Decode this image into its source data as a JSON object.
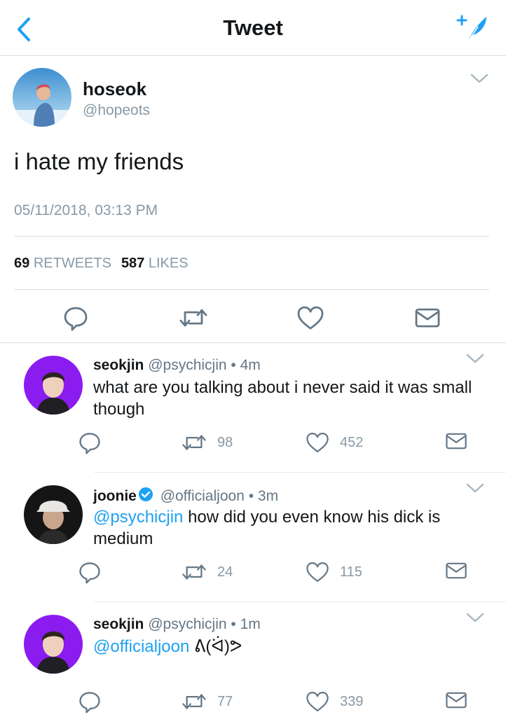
{
  "navbar": {
    "title": "Tweet",
    "back_icon": "chevron-left-icon",
    "compose_icon": "compose-feather-icon",
    "accent_color": "#1da1f2"
  },
  "main_tweet": {
    "name": "hoseok",
    "handle": "@hopeots",
    "text": "i hate my friends",
    "timestamp": "05/11/2018, 03:13 PM",
    "retweets_count": "69",
    "retweets_label": "RETWEETS",
    "likes_count": "587",
    "likes_label": "LIKES"
  },
  "replies": [
    {
      "name": "seokjin",
      "handle": "@psychicjin",
      "time": "• 4m",
      "verified": false,
      "mention": "",
      "text": "what are you talking about i never said it was small though",
      "retweets": "98",
      "likes": "452"
    },
    {
      "name": "joonie",
      "handle": "@officialjoon",
      "time": "• 3m",
      "verified": true,
      "mention": "@psychicjin",
      "text": " how did you even know his dick is medium",
      "retweets": "24",
      "likes": "115"
    },
    {
      "name": "seokjin",
      "handle": "@psychicjin",
      "time": "• 1m",
      "verified": false,
      "mention": "@officialjoon",
      "text": " ᕕ(ᐛ)ᕗ",
      "retweets": "77",
      "likes": "339"
    }
  ]
}
